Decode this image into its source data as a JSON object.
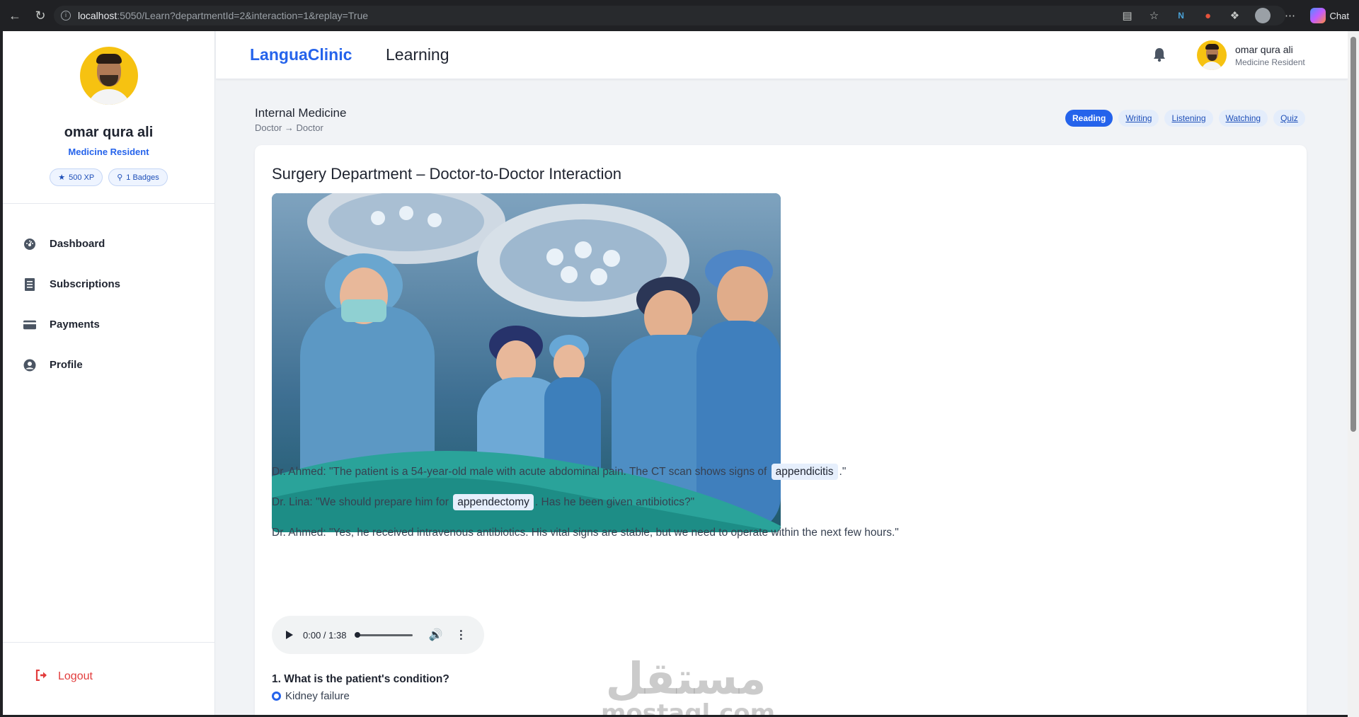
{
  "browser": {
    "url_host": "localhost",
    "url_rest": ":5050/Learn?departmentId=2&interaction=1&replay=True",
    "chat_label": "Chat"
  },
  "sidebar": {
    "user_name": "omar qura ali",
    "user_role": "Medicine Resident",
    "xp_label": "500 XP",
    "badges_label": "1 Badges",
    "menu": [
      {
        "label": "Dashboard",
        "icon": "dashboard-icon"
      },
      {
        "label": "Subscriptions",
        "icon": "receipt-icon"
      },
      {
        "label": "Payments",
        "icon": "credit-card-icon"
      },
      {
        "label": "Profile",
        "icon": "user-circle-icon"
      }
    ],
    "logout_label": "Logout"
  },
  "header": {
    "brand": "LanguaClinic",
    "title": "Learning",
    "user_name": "omar qura ali",
    "user_role": "Medicine Resident"
  },
  "main": {
    "department": "Internal Medicine",
    "breadcrumb": "Doctor → Doctor",
    "tabs": [
      {
        "label": "Reading",
        "active": true
      },
      {
        "label": "Writing",
        "active": false
      },
      {
        "label": "Listening",
        "active": false
      },
      {
        "label": "Watching",
        "active": false
      },
      {
        "label": "Quiz",
        "active": false
      }
    ],
    "card_title": "Surgery Department – Doctor-to-Doctor Interaction",
    "dialogue": [
      {
        "before": "Dr. Ahmed: \"The patient is a 54-year-old male with acute abdominal pain. The CT scan shows signs of",
        "term": "appendicitis",
        "after": ".\""
      },
      {
        "before": "Dr. Lina: \"We should prepare him for",
        "term": "appendectomy",
        "after": ". Has he been given antibiotics?\""
      },
      {
        "before": "Dr. Ahmed: \"Yes, he received intravenous antibiotics. His vital signs are stable, but we need to operate within the next few hours.\"",
        "term": "",
        "after": ""
      }
    ],
    "audio": {
      "time": "0:00 / 1:38"
    },
    "question": "1. What is the patient's condition?",
    "option_first": "Kidney failure"
  },
  "watermark": {
    "arabic": "مستقل",
    "latin": "mostaql.com"
  },
  "colors": {
    "accent": "#2563eb",
    "danger": "#e23c3c",
    "highlight": "#e6effc"
  }
}
